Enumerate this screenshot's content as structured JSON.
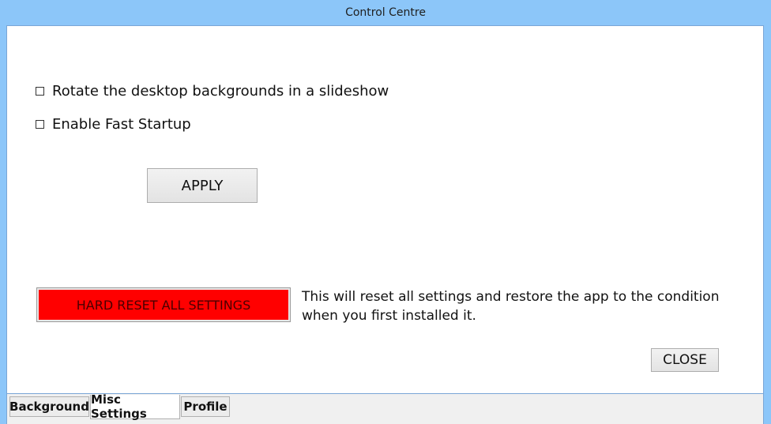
{
  "window": {
    "title": "Control Centre"
  },
  "settings": {
    "checkboxes": [
      {
        "label": "Rotate the desktop backgrounds in a slideshow",
        "checked": false
      },
      {
        "label": "Enable Fast Startup",
        "checked": false
      }
    ],
    "apply_label": "APPLY",
    "reset_label": "HARD RESET ALL SETTINGS",
    "reset_description": "This will reset all settings and restore the app to the condition when you first installed it.",
    "close_label": "CLOSE"
  },
  "tabs": [
    {
      "label": "Background",
      "active": false
    },
    {
      "label": "Misc Settings",
      "active": true
    },
    {
      "label": "Profile",
      "active": false
    }
  ],
  "colors": {
    "frame": "#8cc6f9",
    "reset_button": "#ff0000",
    "client_bg": "#ffffff"
  }
}
